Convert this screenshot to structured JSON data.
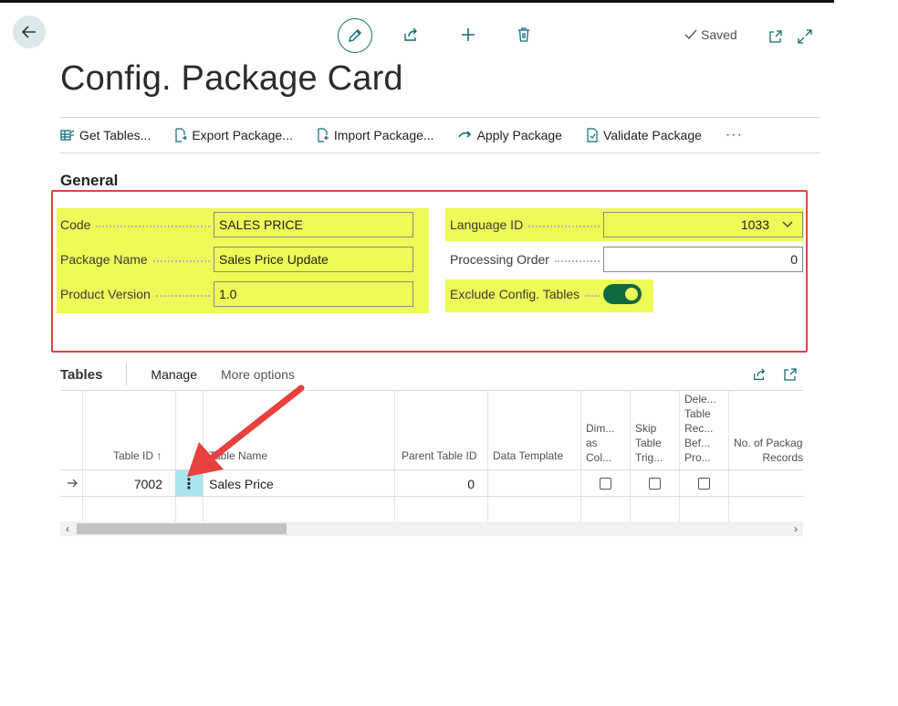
{
  "toolbar": {
    "saved_label": "Saved",
    "icons": [
      "back-arrow-icon",
      "edit-pencil-icon",
      "share-icon",
      "plus-icon",
      "trash-icon",
      "open-new-window-icon",
      "expand-icon"
    ]
  },
  "page": {
    "title": "Config. Package Card"
  },
  "actions": [
    {
      "label": "Get Tables...",
      "icon": "get-tables-icon"
    },
    {
      "label": "Export Package...",
      "icon": "export-doc-icon"
    },
    {
      "label": "Import Package...",
      "icon": "import-doc-icon"
    },
    {
      "label": "Apply Package",
      "icon": "apply-arrow-icon"
    },
    {
      "label": "Validate Package",
      "icon": "validate-doc-icon"
    }
  ],
  "general": {
    "title": "General",
    "code": {
      "label": "Code",
      "value": "SALES PRICE"
    },
    "package_name": {
      "label": "Package Name",
      "value": "Sales Price Update"
    },
    "product_version": {
      "label": "Product Version",
      "value": "1.0"
    },
    "language_id": {
      "label": "Language ID",
      "value": "1033"
    },
    "processing_order": {
      "label": "Processing Order",
      "value": "0"
    },
    "exclude_config_tables": {
      "label": "Exclude Config. Tables",
      "value": true
    }
  },
  "tables": {
    "title": "Tables",
    "links": [
      "Manage",
      "More options"
    ],
    "columns": {
      "table_id": "Table ID ↑",
      "table_name": "Table Name",
      "parent_table_id": "Parent Table ID",
      "data_template": "Data Template",
      "dim_as_col": [
        "Dim...",
        "as",
        "Col..."
      ],
      "skip_table_trig": [
        "Skip",
        "Table",
        "Trig..."
      ],
      "delete_table_rec": [
        "Dele...",
        "Table",
        "Rec...",
        "Bef...",
        "Pro..."
      ],
      "no_of_package_records": [
        "No. of Package",
        "Records"
      ]
    },
    "rows": [
      {
        "table_id": "7002",
        "table_name": "Sales Price",
        "parent_table_id": "0",
        "data_template": ""
      }
    ]
  },
  "colors": {
    "accent": "#0f6b78",
    "highlight": "#eefa57",
    "annotation_red": "#e0433e"
  }
}
